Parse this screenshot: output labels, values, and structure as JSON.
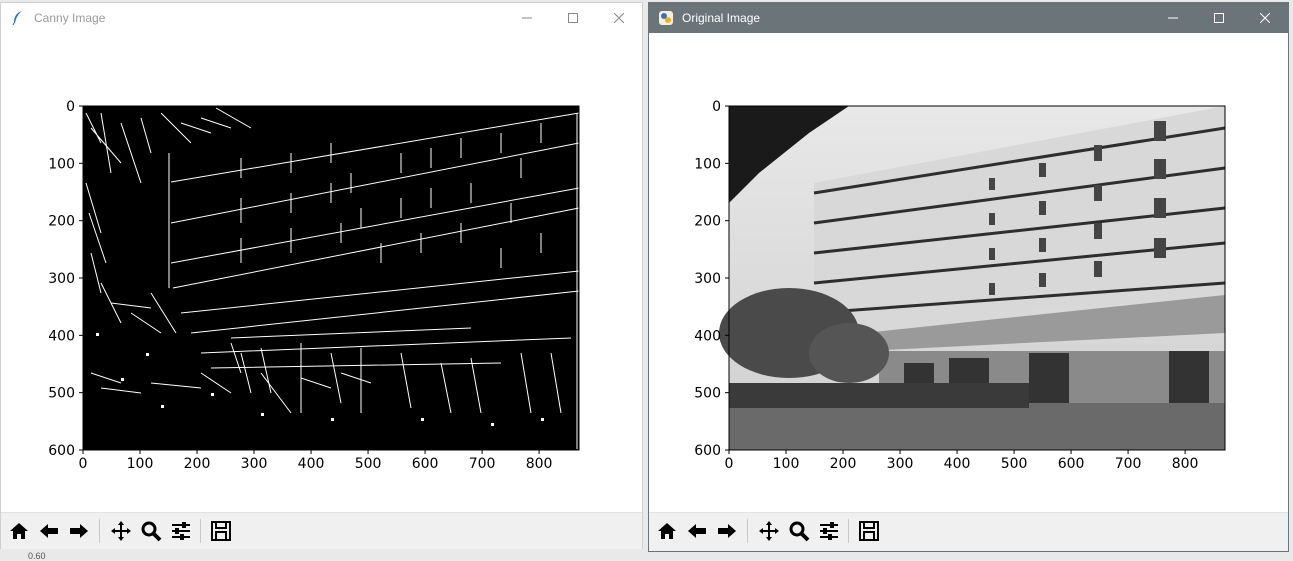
{
  "canny_window": {
    "title": "Canny Image"
  },
  "original_window": {
    "title": "Original Image"
  },
  "window_controls": {
    "minimize": "—",
    "maximize": "☐",
    "close": "✕"
  },
  "plot": {
    "x_ticks": [
      "0",
      "100",
      "200",
      "300",
      "400",
      "500",
      "600",
      "700",
      "800"
    ],
    "y_ticks": [
      "0",
      "100",
      "200",
      "300",
      "400",
      "500",
      "600"
    ]
  },
  "toolbar_icons": [
    "home-icon",
    "back-arrow-icon",
    "forward-arrow-icon",
    "pan-icon",
    "zoom-icon",
    "configure-subplots-icon",
    "save-icon"
  ],
  "status": {
    "text": "0.60"
  },
  "colors": {
    "canny_bg": "#000000",
    "canny_edges": "#ffffff",
    "title_active": "#6b7479"
  }
}
